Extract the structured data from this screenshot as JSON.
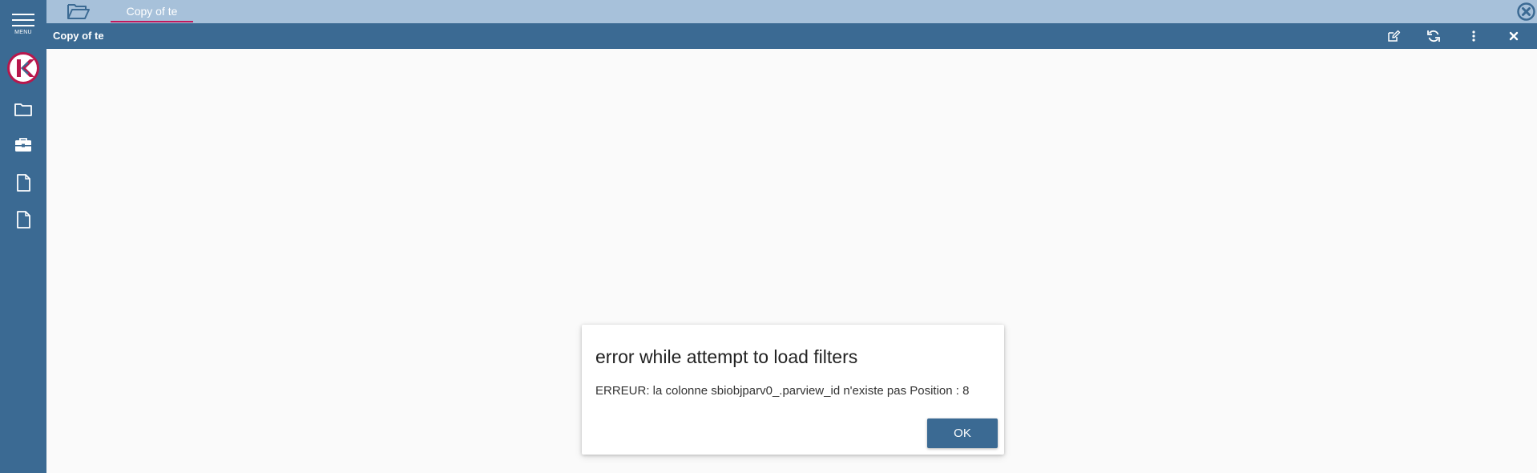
{
  "sidebar": {
    "menu_label": "MENU",
    "logo_letter": "K",
    "items": [
      {
        "icon": "folder-icon"
      },
      {
        "icon": "briefcase-icon"
      },
      {
        "icon": "document-icon"
      },
      {
        "icon": "document-icon"
      }
    ]
  },
  "tabs": [
    {
      "label": "Copy of te",
      "active": true
    }
  ],
  "document": {
    "title": "Copy of te",
    "toolbar": [
      "edit-icon",
      "refresh-icon",
      "more-vertical-icon",
      "close-icon"
    ]
  },
  "dialog": {
    "title": "error while attempt to load filters",
    "message": "ERREUR: la colonne sbiobjparv0_.parview_id n'existe pas Position : 8",
    "ok_label": "OK"
  },
  "colors": {
    "primary": "#3b6a93",
    "tabbar": "#a7c1da",
    "accent": "#c2185b",
    "background": "#fafafa"
  }
}
